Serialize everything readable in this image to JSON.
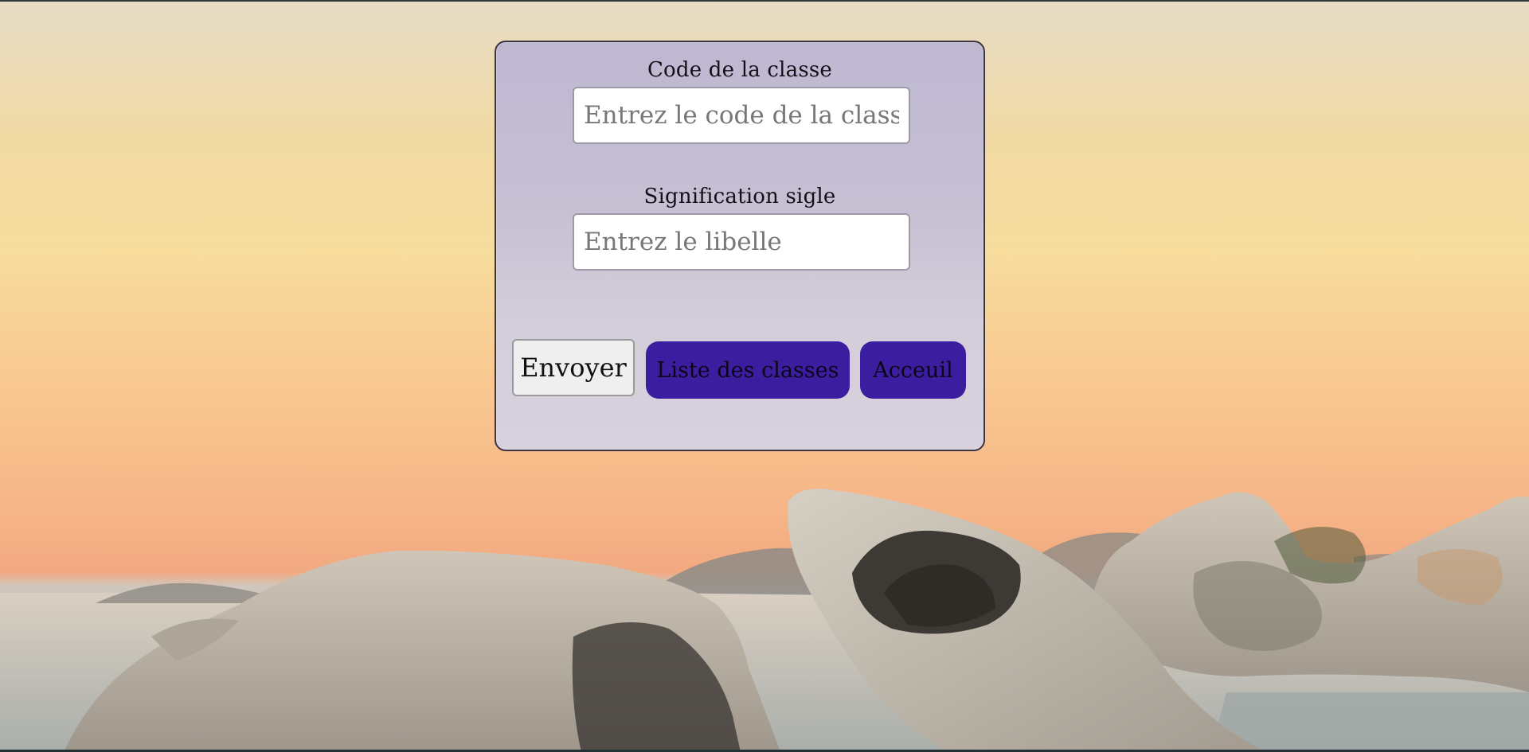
{
  "form": {
    "code_label": "Code de la classe",
    "code_placeholder": "Entrez le code de la classe",
    "code_value": "",
    "sigle_label": "Signification sigle",
    "sigle_placeholder": "Entrez le libelle",
    "sigle_value": ""
  },
  "buttons": {
    "send_label": "Envoyer",
    "list_label": "Liste des classes",
    "home_label": "Acceuil"
  },
  "colors": {
    "accent_button": "#3b1ea0",
    "card_border": "#3a3340"
  }
}
